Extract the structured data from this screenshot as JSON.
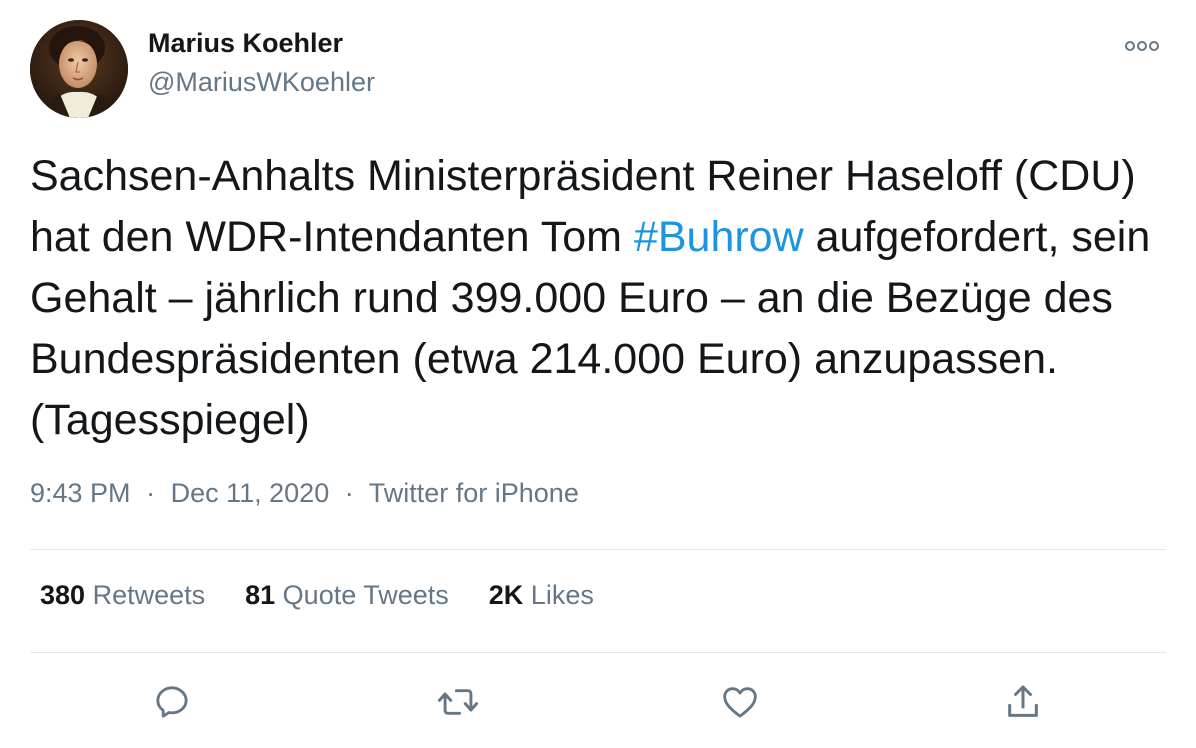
{
  "author": {
    "name": "Marius Koehler",
    "handle": "@MariusWKoehler",
    "avatar_icon": "portrait-avatar"
  },
  "tweet": {
    "text_before": "Sachsen-Anhalts Ministerpräsident Reiner Haseloff (CDU) hat den WDR-Intendanten Tom ",
    "hashtag": "#Buhrow",
    "text_after": " aufgefordert, sein Gehalt – jährlich rund 399.000 Euro – an die Bezüge des Bundespräsidenten (etwa 214.000 Euro) anzupassen. (Tagesspiegel)"
  },
  "meta": {
    "time": "9:43 PM",
    "separator": "·",
    "date": "Dec 11, 2020",
    "source": "Twitter for iPhone"
  },
  "stats": {
    "retweets_count": "380",
    "retweets_label": " Retweets",
    "quotes_count": "81",
    "quotes_label": " Quote Tweets",
    "likes_count": "2K",
    "likes_label": " Likes"
  },
  "actions": {
    "icons": [
      "reply-icon",
      "retweet-icon",
      "like-icon",
      "share-icon"
    ]
  },
  "colors": {
    "text": "#14171a",
    "secondary": "#657786",
    "link": "#1b95e0",
    "divider": "#e1e8ed"
  }
}
